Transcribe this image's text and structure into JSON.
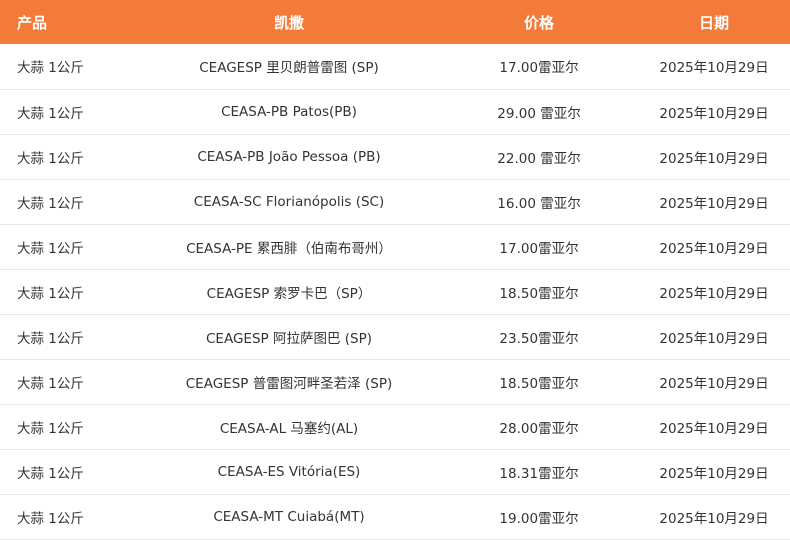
{
  "header": {
    "product": "产品",
    "market": "凯撒",
    "price": "价格",
    "date": "日期"
  },
  "rows": [
    {
      "product": "大蒜 1公斤",
      "market": "CEAGESP 里贝朗普雷图 (SP)",
      "price": "17.00雷亚尔",
      "date": "2025年10月29日"
    },
    {
      "product": "大蒜 1公斤",
      "market": "CEASA-PB Patos(PB)",
      "price": "29.00 雷亚尔",
      "date": "2025年10月29日"
    },
    {
      "product": "大蒜 1公斤",
      "market": "CEASA-PB João Pessoa (PB)",
      "price": "22.00 雷亚尔",
      "date": "2025年10月29日"
    },
    {
      "product": "大蒜 1公斤",
      "market": "CEASA-SC Florianópolis (SC)",
      "price": "16.00 雷亚尔",
      "date": "2025年10月29日"
    },
    {
      "product": "大蒜 1公斤",
      "market": "CEASA-PE 累西腓（伯南布哥州）",
      "price": "17.00雷亚尔",
      "date": "2025年10月29日"
    },
    {
      "product": "大蒜 1公斤",
      "market": "CEAGESP 索罗卡巴（SP）",
      "price": "18.50雷亚尔",
      "date": "2025年10月29日"
    },
    {
      "product": "大蒜 1公斤",
      "market": "CEAGESP 阿拉萨图巴 (SP)",
      "price": "23.50雷亚尔",
      "date": "2025年10月29日"
    },
    {
      "product": "大蒜 1公斤",
      "market": "CEAGESP 普雷图河畔圣若泽 (SP)",
      "price": "18.50雷亚尔",
      "date": "2025年10月29日"
    },
    {
      "product": "大蒜 1公斤",
      "market": "CEASA-AL 马塞约(AL)",
      "price": "28.00雷亚尔",
      "date": "2025年10月29日"
    },
    {
      "product": "大蒜 1公斤",
      "market": "CEASA-ES Vitória(ES)",
      "price": "18.31雷亚尔",
      "date": "2025年10月29日"
    },
    {
      "product": "大蒜 1公斤",
      "market": "CEASA-MT Cuiabá(MT)",
      "price": "19.00雷亚尔",
      "date": "2025年10月29日"
    }
  ],
  "colors": {
    "header_bg": "#f47a3a",
    "header_text": "#ffffff",
    "row_text": "#333333",
    "divider": "#e8e8e8"
  }
}
